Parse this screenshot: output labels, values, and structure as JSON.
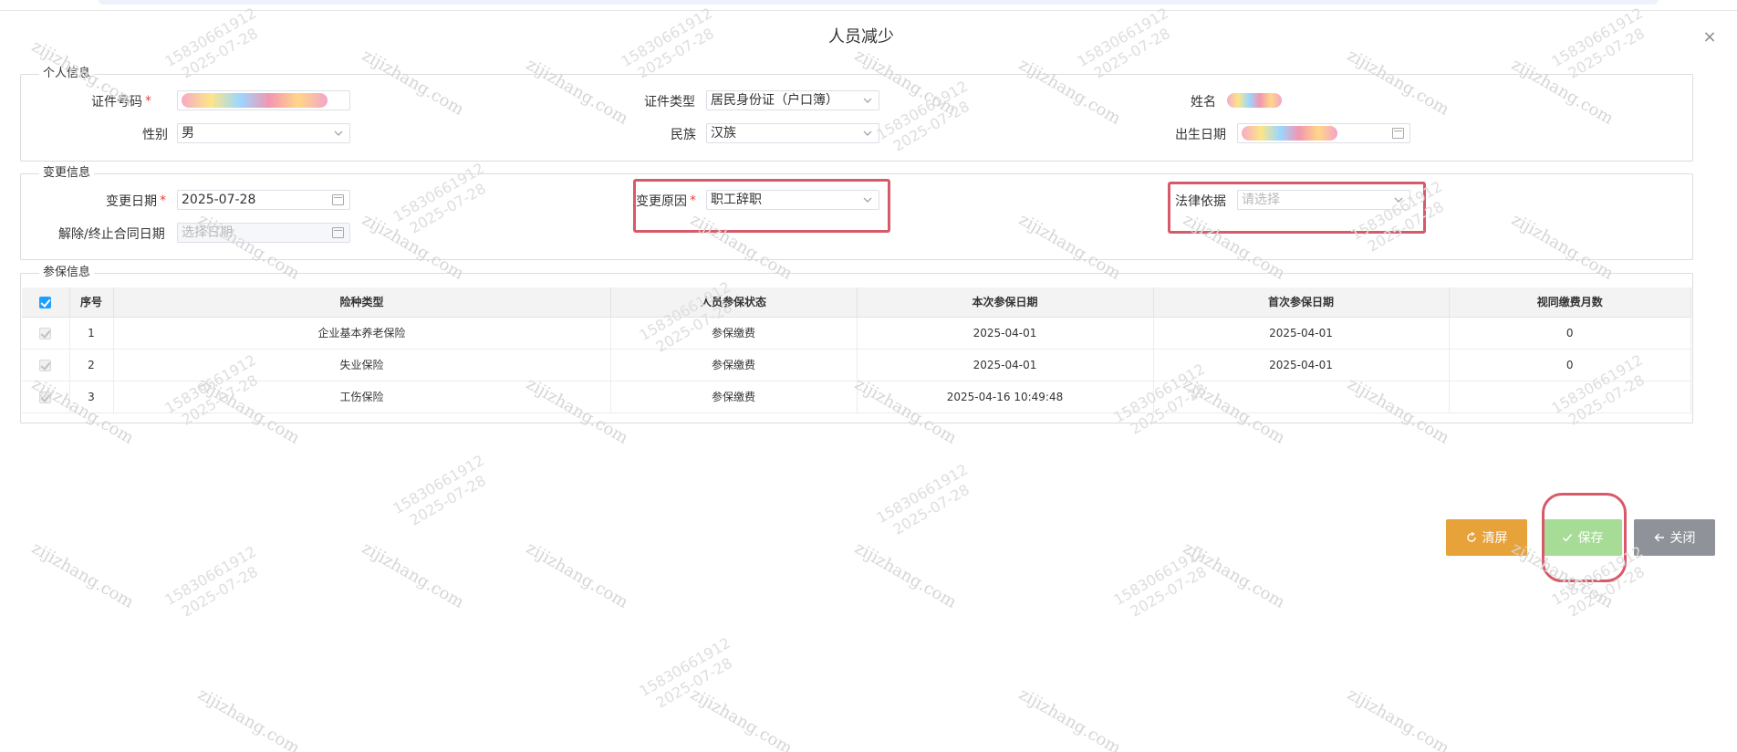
{
  "dialog": {
    "title": "人员减少",
    "close_glyph": "×"
  },
  "personal": {
    "legend": "个人信息",
    "id_number_label": "证件号码",
    "id_type_label": "证件类型",
    "id_type_value": "居民身份证（户口簿）",
    "name_label": "姓名",
    "gender_label": "性别",
    "gender_value": "男",
    "ethnicity_label": "民族",
    "ethnicity_value": "汉族",
    "birth_date_label": "出生日期"
  },
  "change": {
    "legend": "变更信息",
    "change_date_label": "变更日期",
    "change_date_value": "2025-07-28",
    "reason_label": "变更原因",
    "reason_value": "职工辞职",
    "legal_basis_label": "法律依据",
    "legal_basis_placeholder": "请选择",
    "contract_end_label": "解除/终止合同日期",
    "contract_end_placeholder": "选择日期"
  },
  "insurance": {
    "legend": "参保信息",
    "columns": [
      "序号",
      "险种类型",
      "人员参保状态",
      "本次参保日期",
      "首次参保日期",
      "视同缴费月数"
    ],
    "rows": [
      {
        "no": "1",
        "type": "企业基本养老保险",
        "status": "参保缴费",
        "this_date": "2025-04-01",
        "first_date": "2025-04-01",
        "months": "0"
      },
      {
        "no": "2",
        "type": "失业保险",
        "status": "参保缴费",
        "this_date": "2025-04-01",
        "first_date": "2025-04-01",
        "months": "0"
      },
      {
        "no": "3",
        "type": "工伤保险",
        "status": "参保缴费",
        "this_date": "2025-04-16 10:49:48",
        "first_date": "",
        "months": ""
      }
    ]
  },
  "buttons": {
    "clear_label": "清屏",
    "save_label": "保存",
    "close_label": "关闭"
  },
  "watermark": {
    "site": "zijizhang.com",
    "phone": "15830661912",
    "date": "2025-07-28"
  },
  "colors": {
    "primary_checkbox": "#1e9fff",
    "highlight": "#d65a6a",
    "clear_button": "#e8a23a",
    "save_button": "#a6dc95",
    "close_button": "#8f9399",
    "required_star": "#e64340"
  }
}
